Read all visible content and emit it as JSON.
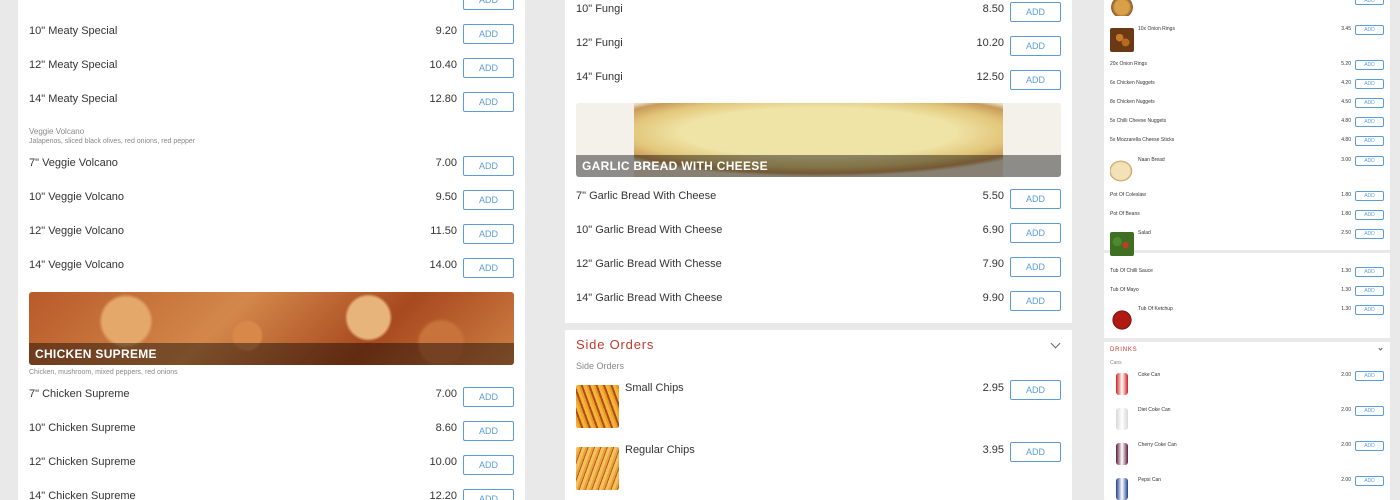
{
  "add_label": "ADD",
  "left": {
    "items_top": [
      {
        "name": "10\" Meaty Special",
        "price": "9.20"
      },
      {
        "name": "12\" Meaty Special",
        "price": "10.40"
      },
      {
        "name": "14\" Meaty Special",
        "price": "12.80"
      }
    ],
    "veggie": {
      "title": "Veggie Volcano",
      "desc": "Jalapenos, sliced black olives, red onions, red pepper",
      "items": [
        {
          "name": "7\" Veggie Volcano",
          "price": "7.00"
        },
        {
          "name": "10\" Veggie Volcano",
          "price": "9.50"
        },
        {
          "name": "12\" Veggie Volcano",
          "price": "11.50"
        },
        {
          "name": "14\" Veggie Volcano",
          "price": "14.00"
        }
      ]
    },
    "chicken": {
      "title": "CHICKEN SUPREME",
      "desc": "Chicken, mushroom, mixed peppers, red onions",
      "items": [
        {
          "name": "7\" Chicken Supreme",
          "price": "7.00"
        },
        {
          "name": "10\" Chicken Supreme",
          "price": "8.60"
        },
        {
          "name": "12\" Chicken Supreme",
          "price": "10.00"
        },
        {
          "name": "14\" Chicken Supreme",
          "price": "12.20"
        }
      ]
    }
  },
  "middle": {
    "fungi_items": [
      {
        "name": "10\" Fungi",
        "price": "8.50"
      },
      {
        "name": "12\" Fungi",
        "price": "10.20"
      },
      {
        "name": "14\" Fungi",
        "price": "12.50"
      }
    ],
    "garlic": {
      "title": "GARLIC BREAD WITH CHEESE",
      "items": [
        {
          "name": "7\" Garlic Bread With Cheese",
          "price": "5.50"
        },
        {
          "name": "10\" Garlic Bread With Cheese",
          "price": "6.90"
        },
        {
          "name": "12\" Garlic Bread With Chesse",
          "price": "7.90"
        },
        {
          "name": "14\" Garlic Bread With Cheese",
          "price": "9.90"
        }
      ]
    },
    "side_orders": {
      "heading": "Side Orders",
      "subheading": "Side Orders",
      "items": [
        {
          "name": "Small Chips",
          "price": "2.95"
        },
        {
          "name": "Regular Chips",
          "price": "3.95"
        }
      ]
    }
  },
  "right": {
    "items": [
      {
        "name": "10x Onion Rings",
        "price": "3.45",
        "thumb": "onion-rings"
      },
      {
        "name": "20x Onion Rings",
        "price": "5.20",
        "thumb": ""
      },
      {
        "name": "6x Chicken Nuggets",
        "price": "4.20",
        "thumb": ""
      },
      {
        "name": "8x Chicken Nuggets",
        "price": "4.50",
        "thumb": ""
      },
      {
        "name": "5x Chilli Cheese Nuggets",
        "price": "4.80",
        "thumb": ""
      },
      {
        "name": "5x Mozzarella Cheese Sticks",
        "price": "4.80",
        "thumb": ""
      },
      {
        "name": "Naan Bread",
        "price": "3.00",
        "thumb": "naan"
      },
      {
        "name": "Pot Of Coleslaw",
        "price": "1.80",
        "thumb": ""
      },
      {
        "name": "Pot Of Beans",
        "price": "1.80",
        "thumb": ""
      },
      {
        "name": "Salad",
        "price": "2.50",
        "thumb": "salad"
      },
      {
        "name": "Tub Of Chilli Sauce",
        "price": "1.30",
        "thumb": ""
      },
      {
        "name": "Tub Of Mayo",
        "price": "1.30",
        "thumb": ""
      },
      {
        "name": "Tub Of Ketchup",
        "price": "1.30",
        "thumb": "ketchup"
      }
    ],
    "drinks": {
      "heading": "DRINKS",
      "subheading": "Cans",
      "items": [
        {
          "name": "Coke Can",
          "price": "2.00"
        },
        {
          "name": "Diet Coke Can",
          "price": "2.00"
        },
        {
          "name": "Cherry Coke Can",
          "price": "2.00"
        },
        {
          "name": "Pepsi Can",
          "price": "2.00"
        }
      ]
    }
  },
  "colors": {
    "accent": "#c0392b",
    "button": "#5a9dd8"
  }
}
